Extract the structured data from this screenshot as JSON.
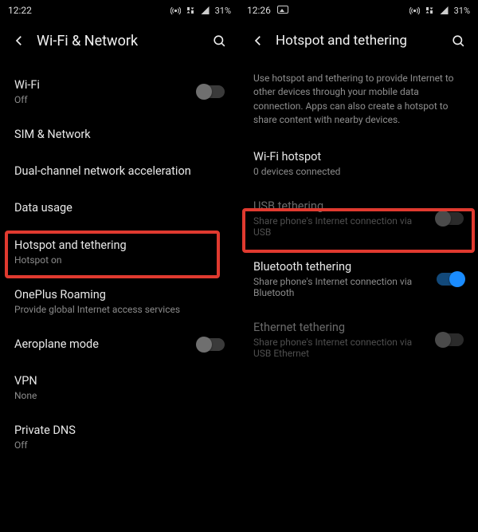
{
  "left": {
    "status": {
      "time": "12:22",
      "battery": "31%"
    },
    "header_title": "Wi-Fi & Network",
    "items": {
      "wifi": {
        "label": "Wi-Fi",
        "sub": "Off"
      },
      "sim": {
        "label": "SIM & Network"
      },
      "dualch": {
        "label": "Dual-channel network acceleration"
      },
      "datausage": {
        "label": "Data usage"
      },
      "hotspot": {
        "label": "Hotspot and tethering",
        "sub": "Hotspot on"
      },
      "roaming": {
        "label": "OnePlus Roaming",
        "sub": "Provide global Internet access services"
      },
      "aeroplane": {
        "label": "Aeroplane mode"
      },
      "vpn": {
        "label": "VPN",
        "sub": "None"
      },
      "pdns": {
        "label": "Private DNS",
        "sub": "Off"
      }
    }
  },
  "right": {
    "status": {
      "time": "12:26",
      "battery": "31%"
    },
    "header_title": "Hotspot and tethering",
    "description": "Use hotspot and tethering to provide Internet to other devices through your mobile data connection. Apps can also create a hotspot to share content with nearby devices.",
    "items": {
      "wifihs": {
        "label": "Wi-Fi hotspot",
        "sub": "0 devices connected"
      },
      "usb": {
        "label": "USB tethering",
        "sub": "Share phone's Internet connection via USB"
      },
      "bt": {
        "label": "Bluetooth tethering",
        "sub": "Share phone's Internet connection via Bluetooth"
      },
      "eth": {
        "label": "Ethernet tethering",
        "sub": "Share phone's Internet connection via USB Ethernet"
      }
    }
  }
}
